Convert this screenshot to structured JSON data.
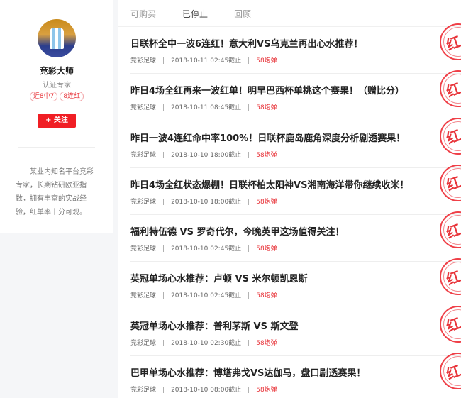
{
  "profile": {
    "name": "竞彩大师",
    "cert": "认证专家",
    "tags": [
      "近8中7",
      "8连红"
    ],
    "follow_label": "+ 关注",
    "description": "某业内知名平台竞彩专家，长期钻研欧亚指数，拥有丰富的实战经验，红单率十分可观。"
  },
  "tabs": [
    {
      "label": "可购买"
    },
    {
      "label": "已停止"
    },
    {
      "label": "回顾"
    }
  ],
  "stamp_text": "红",
  "accent": "#e8343a",
  "items": [
    {
      "title": "日联杯全中一波6连红！意大利VS乌克兰再出心水推荐！",
      "category": "竞彩足球",
      "time": "2018-10-11 02:45截止",
      "cost": "58炮弹"
    },
    {
      "title": "昨日4场全红再来一波红单！明早巴西杯单挑这个赛果！（赠比分）",
      "category": "竞彩足球",
      "time": "2018-10-11 08:45截止",
      "cost": "58炮弹"
    },
    {
      "title": "昨日一波4连红命中率100%！日联杯鹿岛鹿角深度分析剧透赛果！",
      "category": "竞彩足球",
      "time": "2018-10-10 18:00截止",
      "cost": "58炮弹"
    },
    {
      "title": "昨日4场全红状态爆棚！日联杯柏太阳神VS湘南海洋带你继续收米！",
      "category": "竞彩足球",
      "time": "2018-10-10 18:00截止",
      "cost": "58炮弹"
    },
    {
      "title": "福利特伍德 VS 罗奇代尔，今晚英甲这场值得关注！",
      "category": "竞彩足球",
      "time": "2018-10-10 02:45截止",
      "cost": "58炮弹"
    },
    {
      "title": "英冠单场心水推荐：卢顿 VS 米尔顿凯恩斯",
      "category": "竞彩足球",
      "time": "2018-10-10 02:45截止",
      "cost": "58炮弹"
    },
    {
      "title": "英冠单场心水推荐：普利茅斯 VS 斯文登",
      "category": "竞彩足球",
      "time": "2018-10-10 02:30截止",
      "cost": "58炮弹"
    },
    {
      "title": "巴甲单场心水推荐：博塔弗戈VS达伽马，盘口剧透赛果！",
      "category": "竞彩足球",
      "time": "2018-10-10 08:00截止",
      "cost": "58炮弹"
    }
  ]
}
